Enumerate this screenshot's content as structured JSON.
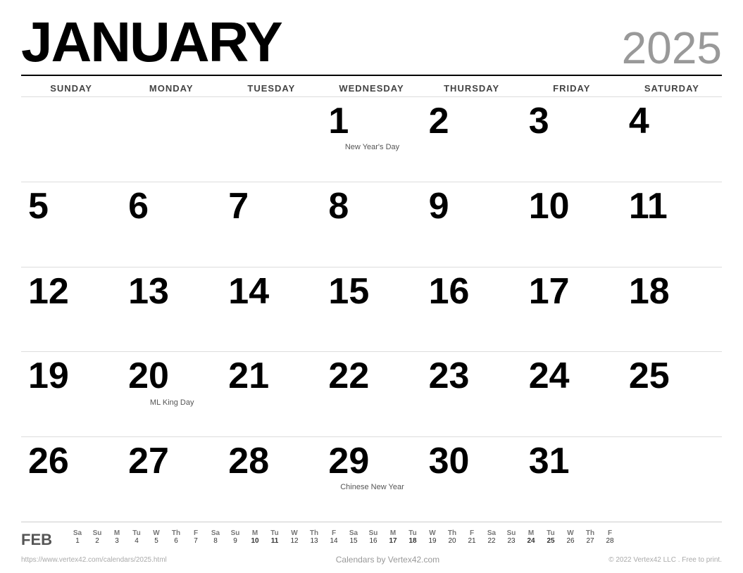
{
  "header": {
    "month": "JANUARY",
    "year": "2025"
  },
  "dayHeaders": [
    "SUNDAY",
    "MONDAY",
    "TUESDAY",
    "WEDNESDAY",
    "THURSDAY",
    "FRIDAY",
    "SATURDAY"
  ],
  "weeks": [
    [
      {
        "day": "",
        "holiday": ""
      },
      {
        "day": "",
        "holiday": ""
      },
      {
        "day": "",
        "holiday": ""
      },
      {
        "day": "1",
        "holiday": "New Year's Day"
      },
      {
        "day": "2",
        "holiday": ""
      },
      {
        "day": "3",
        "holiday": ""
      },
      {
        "day": "4",
        "holiday": ""
      }
    ],
    [
      {
        "day": "5",
        "holiday": ""
      },
      {
        "day": "6",
        "holiday": ""
      },
      {
        "day": "7",
        "holiday": ""
      },
      {
        "day": "8",
        "holiday": ""
      },
      {
        "day": "9",
        "holiday": ""
      },
      {
        "day": "10",
        "holiday": ""
      },
      {
        "day": "11",
        "holiday": ""
      }
    ],
    [
      {
        "day": "12",
        "holiday": ""
      },
      {
        "day": "13",
        "holiday": ""
      },
      {
        "day": "14",
        "holiday": ""
      },
      {
        "day": "15",
        "holiday": ""
      },
      {
        "day": "16",
        "holiday": ""
      },
      {
        "day": "17",
        "holiday": ""
      },
      {
        "day": "18",
        "holiday": ""
      }
    ],
    [
      {
        "day": "19",
        "holiday": ""
      },
      {
        "day": "20",
        "holiday": "ML King Day"
      },
      {
        "day": "21",
        "holiday": ""
      },
      {
        "day": "22",
        "holiday": ""
      },
      {
        "day": "23",
        "holiday": ""
      },
      {
        "day": "24",
        "holiday": ""
      },
      {
        "day": "25",
        "holiday": ""
      }
    ],
    [
      {
        "day": "26",
        "holiday": ""
      },
      {
        "day": "27",
        "holiday": ""
      },
      {
        "day": "28",
        "holiday": ""
      },
      {
        "day": "29",
        "holiday": "Chinese New Year"
      },
      {
        "day": "30",
        "holiday": ""
      },
      {
        "day": "31",
        "holiday": ""
      },
      {
        "day": "",
        "holiday": ""
      }
    ]
  ],
  "miniCalendar": {
    "label": "FEB",
    "headers": [
      "Sa",
      "Su",
      "M",
      "Tu",
      "W",
      "Th",
      "F",
      "Sa",
      "Su",
      "M",
      "Tu",
      "W",
      "Th",
      "F",
      "Sa",
      "Su",
      "M",
      "Tu",
      "W",
      "Th",
      "F",
      "Sa",
      "Su",
      "M",
      "Tu",
      "W",
      "Th",
      "F"
    ],
    "row1": [
      "1",
      "2",
      "3",
      "4",
      "5",
      "6",
      "7",
      "8",
      "9",
      "10",
      "11",
      "12",
      "13",
      "14",
      "15",
      "16",
      "17",
      "18",
      "19",
      "20",
      "21",
      "22",
      "23",
      "24",
      "25",
      "26",
      "27",
      "28"
    ]
  },
  "footer": {
    "url": "https://www.vertex42.com/calendars/2025.html",
    "center": "Calendars by Vertex42.com",
    "copyright": "© 2022 Vertex42 LLC . Free to print."
  }
}
